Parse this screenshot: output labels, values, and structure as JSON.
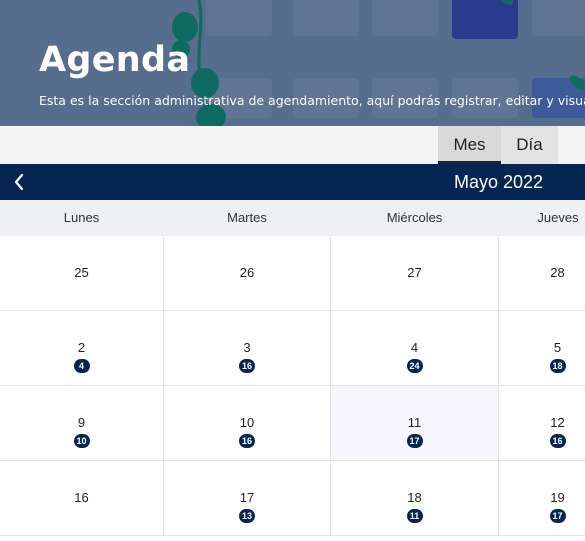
{
  "header": {
    "title": "Agenda",
    "subtitle": "Esta es la sección administrativa de agendamiento, aquí podrás registrar, editar y visualizar tu agenda"
  },
  "view_tabs": [
    {
      "label": "Mes",
      "selected": true
    },
    {
      "label": "Día",
      "selected": false
    }
  ],
  "calendar": {
    "month_label": "Mayo 2022",
    "weekdays": [
      "Lunes",
      "Martes",
      "Miércoles",
      "Jueves"
    ],
    "today_day": "11",
    "weeks": [
      [
        {
          "day": "25",
          "count": ""
        },
        {
          "day": "26",
          "count": ""
        },
        {
          "day": "27",
          "count": ""
        },
        {
          "day": "28",
          "count": ""
        }
      ],
      [
        {
          "day": "2",
          "count": "4"
        },
        {
          "day": "3",
          "count": "16"
        },
        {
          "day": "4",
          "count": "24"
        },
        {
          "day": "5",
          "count": "18"
        }
      ],
      [
        {
          "day": "9",
          "count": "10"
        },
        {
          "day": "10",
          "count": "16"
        },
        {
          "day": "11",
          "count": "17"
        },
        {
          "day": "12",
          "count": "16"
        }
      ],
      [
        {
          "day": "16",
          "count": ""
        },
        {
          "day": "17",
          "count": "13"
        },
        {
          "day": "18",
          "count": "11"
        },
        {
          "day": "19",
          "count": "17"
        }
      ]
    ]
  },
  "colors": {
    "primary": "#052553",
    "hero_bg": "#566d8d",
    "leaf": "#0f6a61",
    "today_bg": "#f6f6fc"
  }
}
